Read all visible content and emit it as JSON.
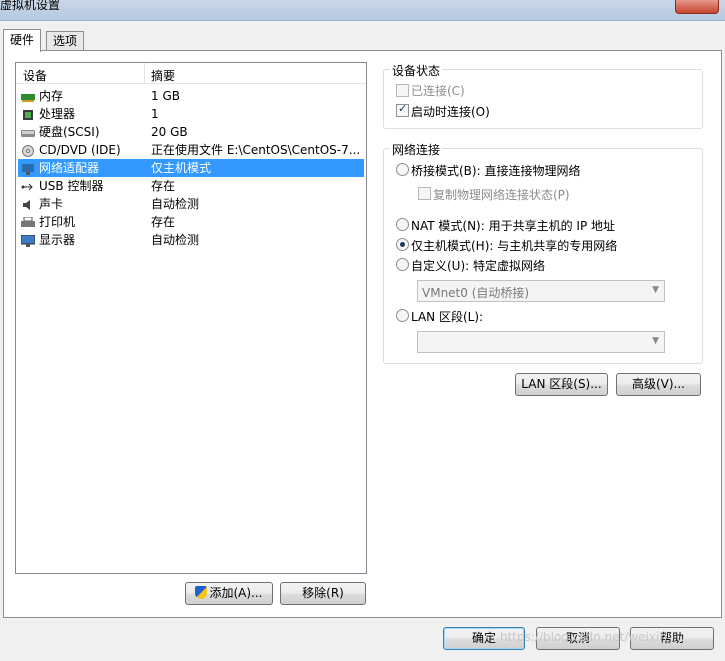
{
  "window": {
    "title": "虚拟机设置"
  },
  "tabs": [
    {
      "label": "硬件"
    },
    {
      "label": "选项"
    }
  ],
  "device_list": {
    "col_device": "设备",
    "col_summary": "摘要",
    "rows": [
      {
        "name": "内存",
        "summary": "1 GB",
        "icon": "memory-icon"
      },
      {
        "name": "处理器",
        "summary": "1",
        "icon": "processor-icon"
      },
      {
        "name": "硬盘(SCSI)",
        "summary": "20 GB",
        "icon": "harddisk-icon"
      },
      {
        "name": "CD/DVD (IDE)",
        "summary": "正在使用文件 E:\\CentOS\\CentOS-7...",
        "icon": "cd-dvd-icon"
      },
      {
        "name": "网络适配器",
        "summary": "仅主机模式",
        "icon": "network-adapter-icon"
      },
      {
        "name": "USB 控制器",
        "summary": "存在",
        "icon": "usb-icon"
      },
      {
        "name": "声卡",
        "summary": "自动检测",
        "icon": "sound-card-icon"
      },
      {
        "name": "打印机",
        "summary": "存在",
        "icon": "printer-icon"
      },
      {
        "name": "显示器",
        "summary": "自动检测",
        "icon": "display-icon"
      }
    ],
    "selected_index": 4
  },
  "buttons": {
    "add": "添加(A)...",
    "remove": "移除(R)",
    "ok": "确定",
    "cancel": "取消",
    "help": "帮助"
  },
  "device_status": {
    "title": "设备状态",
    "connected": "已连接(C)",
    "connect_on_start": "启动时连接(O)",
    "connected_checked": false,
    "connect_on_start_checked": true
  },
  "network": {
    "title": "网络连接",
    "bridged": "桥接模式(B): 直接连接物理网络",
    "replicate": "复制物理网络连接状态(P)",
    "nat": "NAT 模式(N): 用于共享主机的 IP 地址",
    "host_only": "仅主机模式(H): 与主机共享的专用网络",
    "custom": "自定义(U): 特定虚拟网络",
    "custom_select": "VMnet0 (自动桥接)",
    "lan": "LAN 区段(L):",
    "lan_select": "",
    "selected": "host_only"
  },
  "network_buttons": {
    "lan_segments": "LAN 区段(S)...",
    "advanced": "高级(V)..."
  },
  "watermark": "https://blog.csdn.net/weixin_..."
}
